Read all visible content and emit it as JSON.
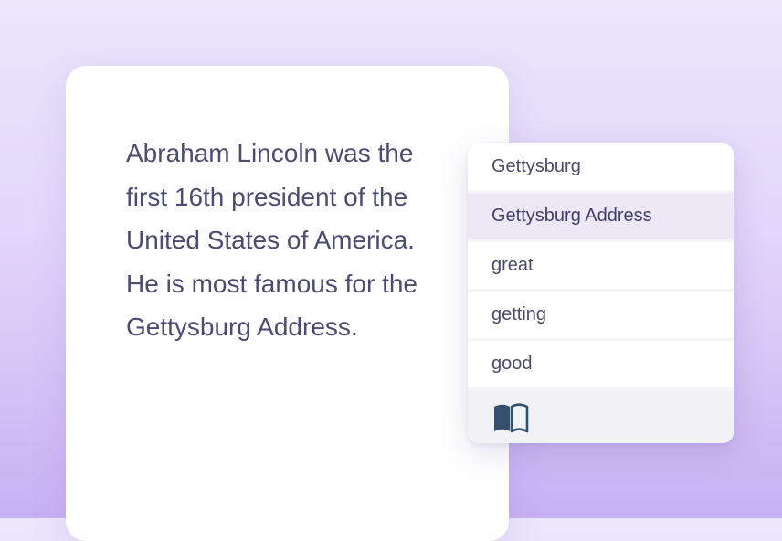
{
  "document": {
    "lines": [
      "Abraham Lincoln was the",
      "first 16th president of the",
      "United States of America.",
      "He is most famous for the",
      "Gettysburg Address."
    ]
  },
  "suggestions": {
    "items": [
      "Gettysburg",
      "Gettysburg Address",
      "great",
      "getting",
      "good"
    ],
    "selected": "Gettysburg Address",
    "footer_icon": "book-icon"
  },
  "colors": {
    "text": "#4a4d70",
    "selected_bg": "#ede7f6",
    "icon": "#35506e",
    "background_top": "#ece6fb",
    "background_bottom": "#c8b1f3"
  }
}
